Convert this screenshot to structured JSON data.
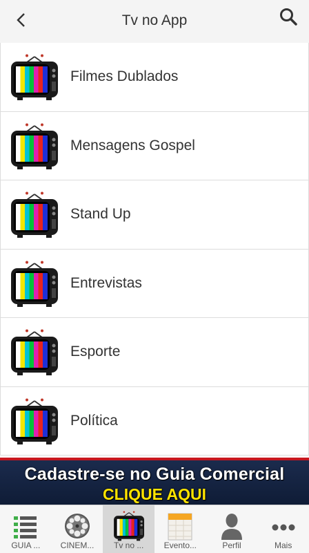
{
  "header": {
    "title": "Tv no App",
    "back_icon": "chevron-left-icon",
    "search_icon": "search-icon"
  },
  "list": {
    "items": [
      {
        "label": "Filmes Dublados",
        "icon": "tv-icon"
      },
      {
        "label": "Mensagens Gospel",
        "icon": "tv-icon"
      },
      {
        "label": "Stand Up",
        "icon": "tv-icon"
      },
      {
        "label": "Entrevistas",
        "icon": "tv-icon"
      },
      {
        "label": "Esporte",
        "icon": "tv-icon"
      },
      {
        "label": "Política",
        "icon": "tv-icon"
      }
    ]
  },
  "banner": {
    "line1": "Cadastre-se no Guia Comercial",
    "line2": "CLIQUE AQUI",
    "accent_color": "#ffe400",
    "background_color": "#1b2b4d"
  },
  "tabbar": {
    "tabs": [
      {
        "label": "GUIA ...",
        "icon": "list-icon",
        "active": false
      },
      {
        "label": "CINEM...",
        "icon": "film-reel-icon",
        "active": false
      },
      {
        "label": "Tv no ...",
        "icon": "tv-icon",
        "active": true
      },
      {
        "label": "Evento...",
        "icon": "calendar-icon",
        "active": false
      },
      {
        "label": "Perfil",
        "icon": "person-icon",
        "active": false
      },
      {
        "label": "Mais",
        "icon": "more-icon",
        "active": false
      }
    ]
  }
}
